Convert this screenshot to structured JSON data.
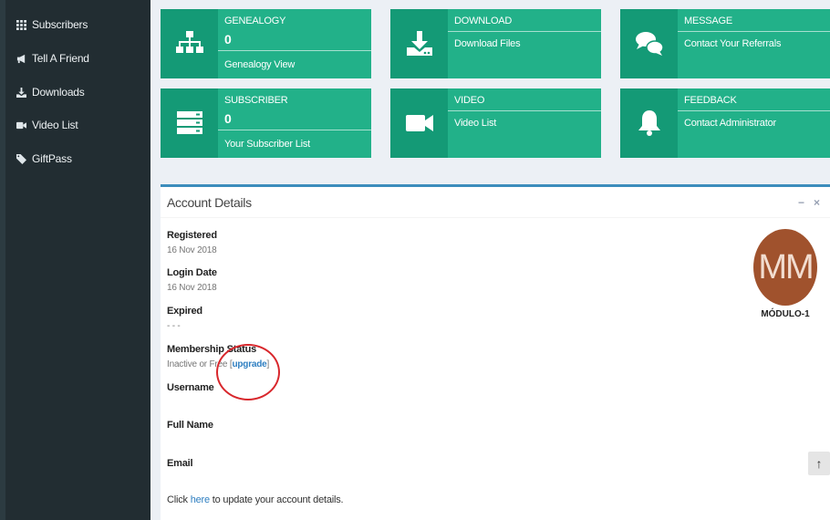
{
  "sidebar": {
    "items": [
      {
        "label": "Subscribers",
        "icon": "grid-icon"
      },
      {
        "label": "Tell A Friend",
        "icon": "bullhorn-icon"
      },
      {
        "label": "Downloads",
        "icon": "download-icon"
      },
      {
        "label": "Video List",
        "icon": "video-camera-icon"
      },
      {
        "label": "GiftPass",
        "icon": "tag-icon"
      }
    ]
  },
  "tiles": [
    {
      "title": "GENEALOGY",
      "number": "0",
      "link": "Genealogy View",
      "icon": "sitemap-icon"
    },
    {
      "title": "DOWNLOAD",
      "link": "Download Files",
      "icon": "download-icon"
    },
    {
      "title": "MESSAGE",
      "link": "Contact Your Referrals",
      "icon": "chat-bubbles-icon"
    },
    {
      "title": "SUBSCRIBER",
      "number": "0",
      "link": "Your Subscriber List",
      "icon": "server-icon"
    },
    {
      "title": "VIDEO",
      "link": "Video List",
      "icon": "video-camera-icon"
    },
    {
      "title": "FEEDBACK",
      "link": "Contact Administrator",
      "icon": "bell-icon"
    }
  ],
  "account": {
    "title": "Account Details",
    "minimize": "−",
    "close": "×",
    "registered_label": "Registered",
    "registered_value": "16 Nov 2018",
    "login_label": "Login Date",
    "login_value": "16 Nov 2018",
    "expired_label": "Expired",
    "expired_value": "- - -",
    "membership_label": "Membership Status",
    "membership_value": "Inactive or Free",
    "upgrade_bracket_open": "[",
    "upgrade_link": "upgrade",
    "upgrade_bracket_close": "]",
    "username_label": "Username",
    "fullname_label": "Full Name",
    "email_label": "Email",
    "footer_prefix": "Click ",
    "footer_link": "here",
    "footer_suffix": " to update your account details.",
    "avatar_initials": "MM",
    "avatar_name": "MÓDULO-1",
    "avatar_color": "#a0522d",
    "scroll_top_arrow": "↑"
  },
  "colors": {
    "tile": "#22b189",
    "tile_icon_bg": "#149a76",
    "sidebar": "#222d32",
    "box_border": "#3c8dbc",
    "highlight_circle": "#d8272c"
  }
}
